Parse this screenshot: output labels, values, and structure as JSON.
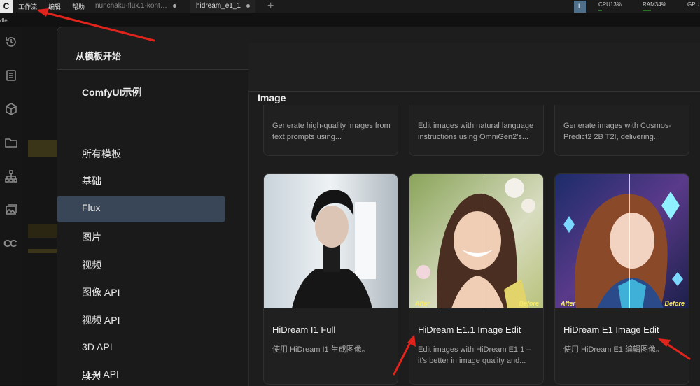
{
  "topbar": {
    "logo": "C",
    "menu": [
      "工作流",
      "编辑",
      "帮助"
    ],
    "tabs": [
      {
        "label": "nunchaku-flux.1-kont…",
        "active": false
      },
      {
        "label": "hidream_e1_1",
        "active": true
      }
    ],
    "user_initial": "L",
    "stats": [
      {
        "label": "CPU13%",
        "value": 0.13
      },
      {
        "label": "RAM34%",
        "value": 0.34
      },
      {
        "label": "GPU",
        "value": 0
      }
    ],
    "subbar_text": "dle"
  },
  "modal": {
    "title": "从模板开始",
    "nav_title": "ComfyUI示例",
    "nav_items": [
      "所有模板",
      "基础",
      "Flux",
      "图片",
      "视频",
      "图像 API",
      "视频 API",
      "3D API",
      "LLM API",
      "放大"
    ],
    "active_nav": "图片",
    "section_title": "Image",
    "top_cards": [
      {
        "desc": "Generate high-quality images from text prompts using..."
      },
      {
        "desc": "Edit images with natural language instructions using OmniGen2's..."
      },
      {
        "desc": "Generate images with Cosmos-Predict2 2B T2I, delivering..."
      }
    ],
    "cards": [
      {
        "title": "HiDream I1 Full",
        "desc": "使用 HiDream I1 生成图像。",
        "thumb": "portrait-dark-hair-icon"
      },
      {
        "title": "HiDream E1.1 Image Edit",
        "desc": "Edit images with HiDream E1.1 – it's better in image quality and...",
        "after": "After",
        "before": "Before",
        "thumb": "portrait-smiling-woman-icon"
      },
      {
        "title": "HiDream E1 Image Edit",
        "desc": "使用 HiDream E1 编辑图像。",
        "after": "After",
        "before": "Before",
        "thumb": "portrait-anime-woman-icon"
      }
    ]
  },
  "colors": {
    "accent_nav": "#394658",
    "annotation_arrow": "#e0241b",
    "label_yellow": "#f7e86a"
  }
}
